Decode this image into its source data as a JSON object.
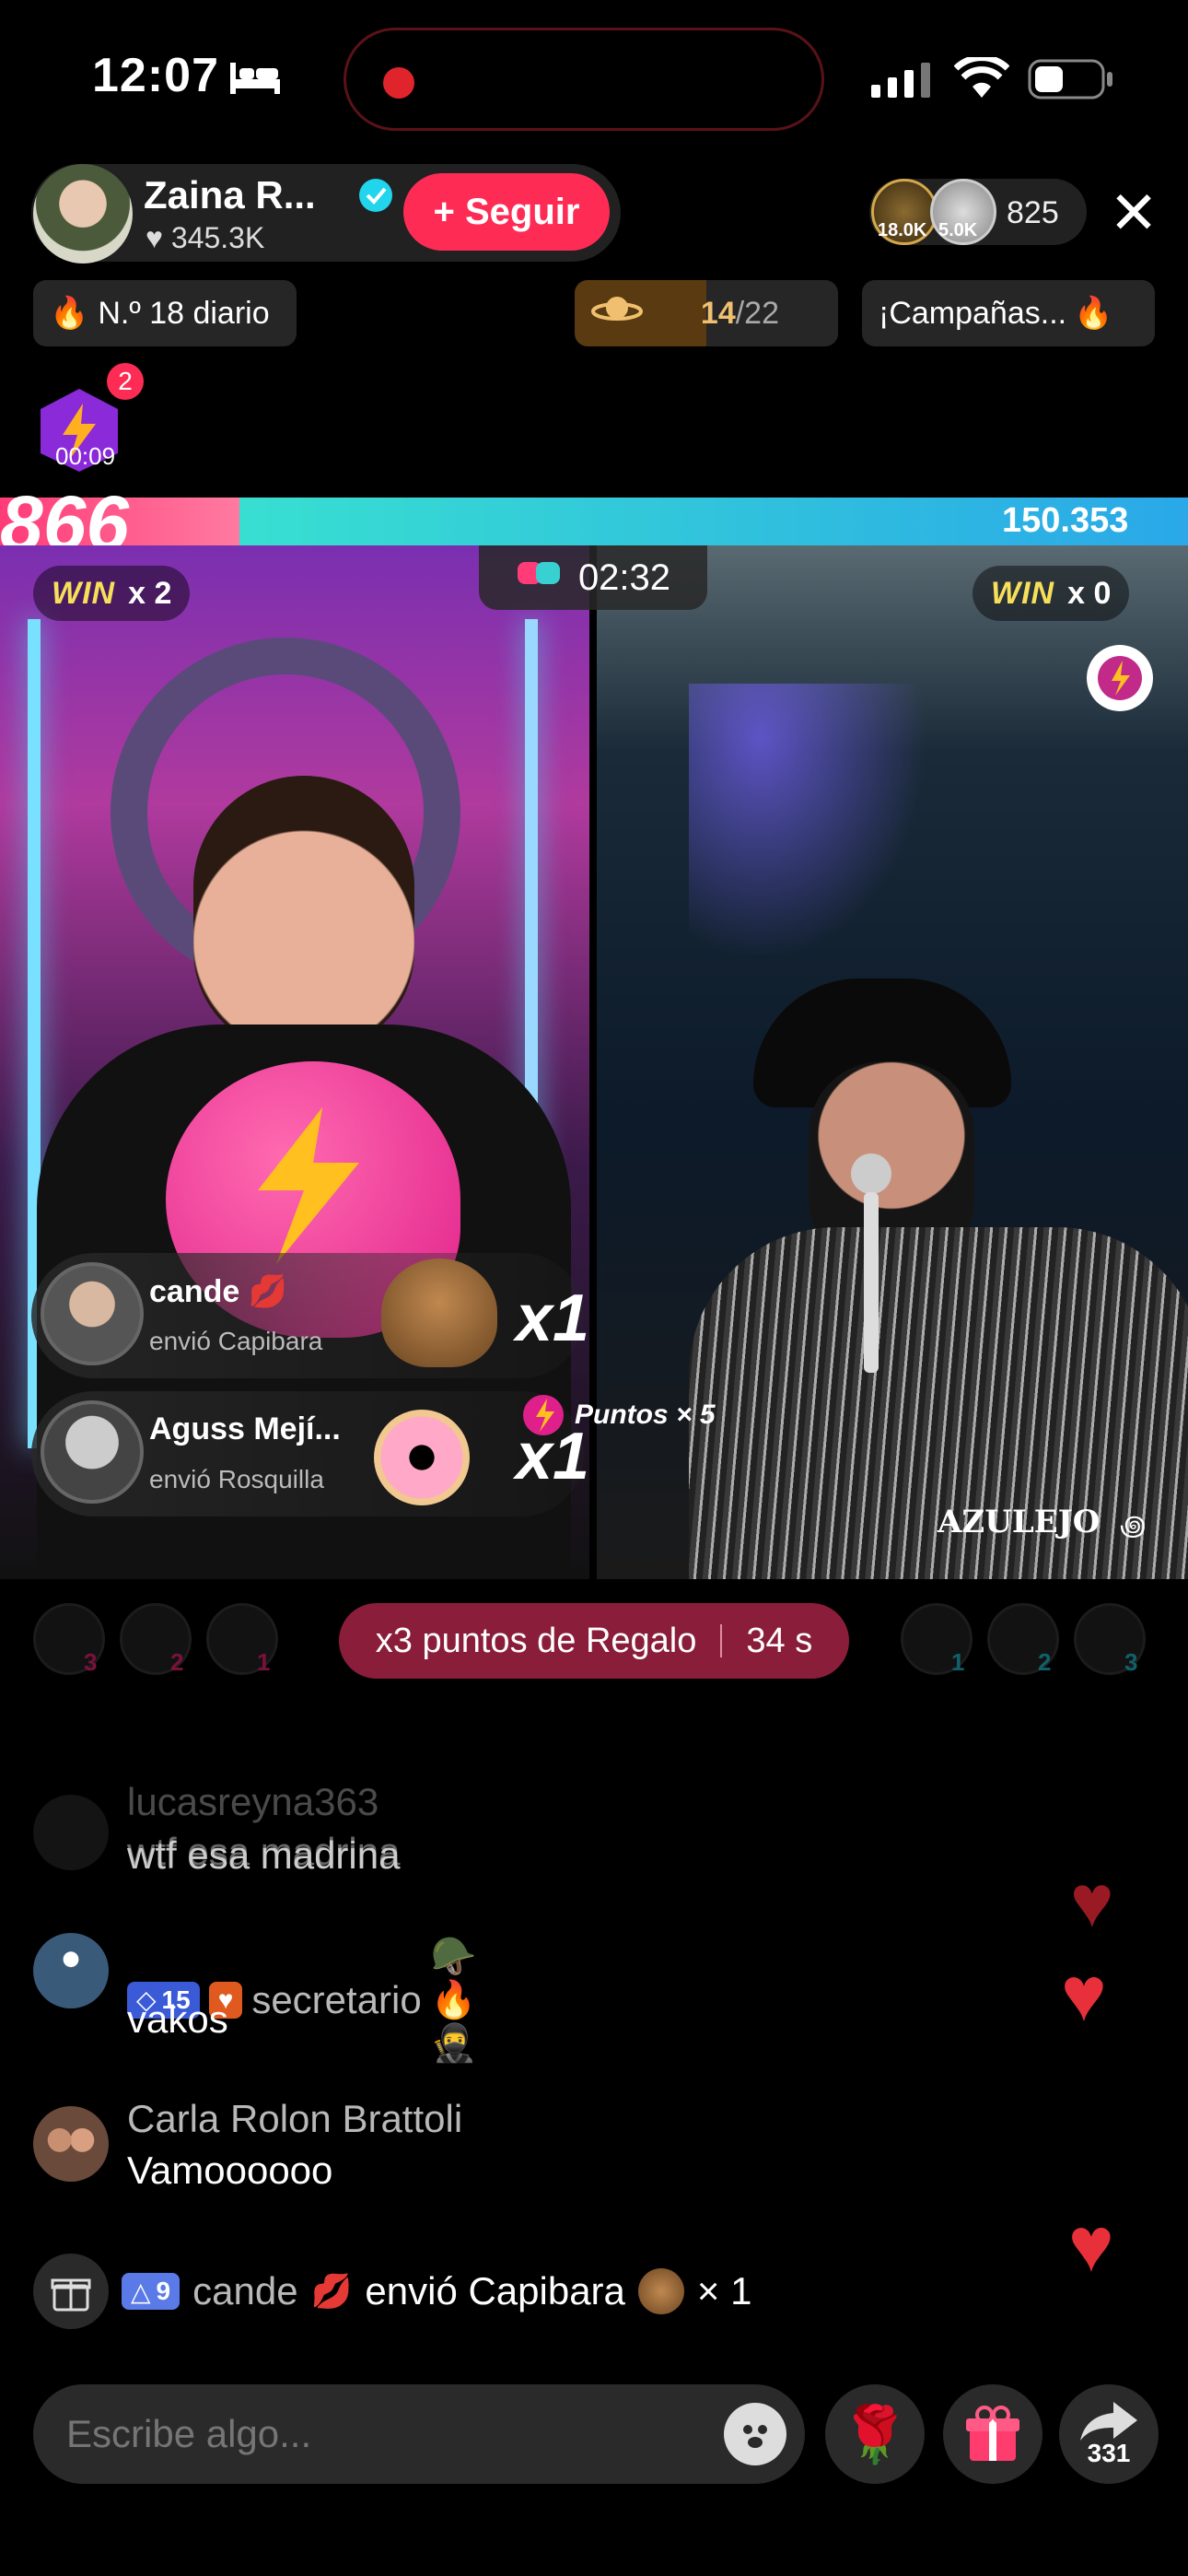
{
  "status_bar": {
    "time": "12:07"
  },
  "host": {
    "name": "Zaina R...",
    "likes": "345.3K",
    "follow_label": "+ Seguir"
  },
  "viewers": {
    "top1": "18.0K",
    "top2": "5.0K",
    "count": "825"
  },
  "chips": {
    "rank": "N.º 18 diario",
    "progress_done": "14",
    "progress_total": "/22",
    "campaigns": "¡Campañas..."
  },
  "boost_badge": {
    "count": "2",
    "time": "00:09"
  },
  "battle": {
    "score_left": "866",
    "score_right": "150.353",
    "timer": "02:32",
    "win_word": "WIN",
    "left_win": "x 2",
    "right_win": "x 0",
    "points_label": "Puntos × 5",
    "watermark": "AZULEJO"
  },
  "gifts": [
    {
      "user": "cande",
      "sub": "envió Capibara",
      "mult": "x1"
    },
    {
      "user": "Aguss Mejí...",
      "sub": "envió Rosquilla",
      "mult": "x1"
    }
  ],
  "contributors_left": [
    "3",
    "2",
    "1"
  ],
  "contributors_right": [
    "1",
    "2",
    "3"
  ],
  "bonus": {
    "label": "x3 puntos de Regalo",
    "seconds": "34 s"
  },
  "chat": [
    {
      "name": "lucasreyna363",
      "msg": "wtf esa madrina"
    },
    {
      "name": "secretario",
      "badge_level": "15",
      "msg": "vakos"
    },
    {
      "name": "Carla Rolon Brattoli",
      "msg": "Vamoooooo"
    }
  ],
  "gift_event": {
    "badge_level": "9",
    "user": "cande",
    "text": "envió Capibara",
    "count": "× 1"
  },
  "input": {
    "placeholder": "Escribe algo..."
  },
  "share_count": "331",
  "colors": {
    "accent": "#fe2c55",
    "win": "#f7df5a",
    "bonus": "#8a1e3a"
  }
}
